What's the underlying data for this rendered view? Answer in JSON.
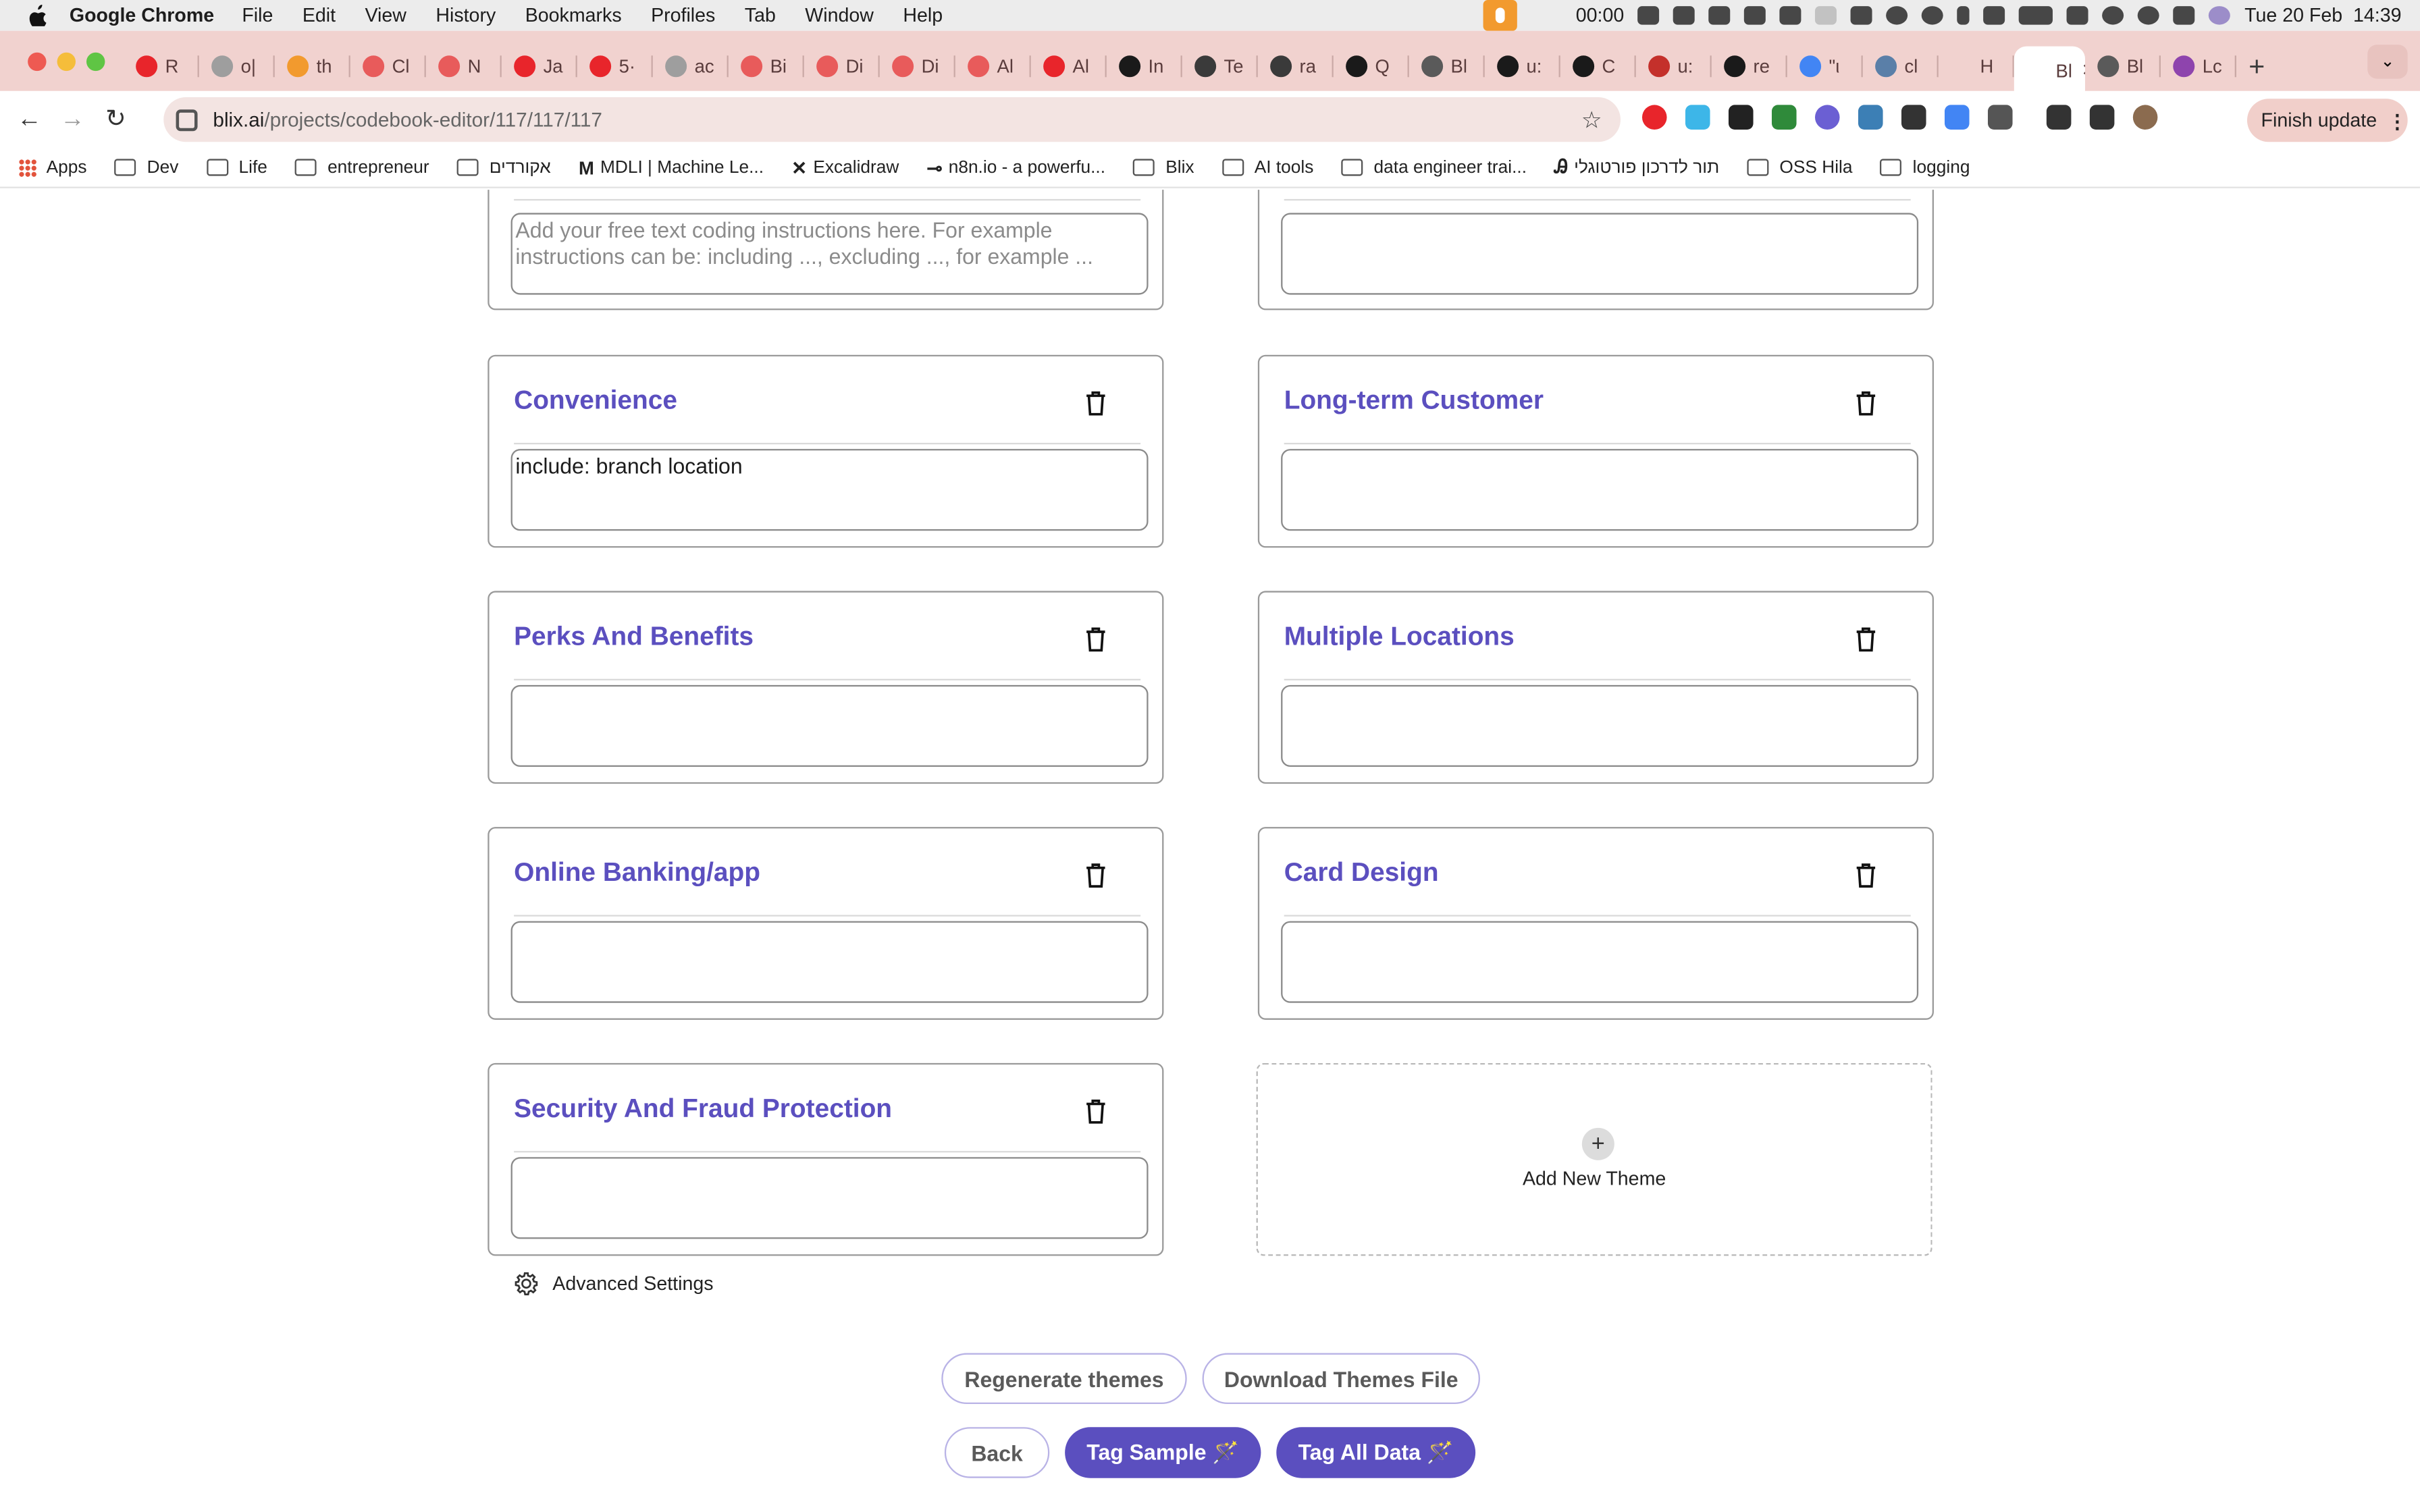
{
  "menubar": {
    "app_name": "Google Chrome",
    "items": [
      "File",
      "Edit",
      "View",
      "History",
      "Bookmarks",
      "Profiles",
      "Tab",
      "Window",
      "Help"
    ],
    "clock": "00:00",
    "datetime": "Tue 20 Feb  14:39"
  },
  "tabs": [
    {
      "label": "R",
      "color": "#e8252b"
    },
    {
      "label": "o|",
      "color": "#9e9e9e"
    },
    {
      "label": "th",
      "color": "#f29a2e"
    },
    {
      "label": "Cl",
      "color": "#e85b5b"
    },
    {
      "label": "N",
      "color": "#e85b5b"
    },
    {
      "label": "Ja",
      "color": "#e8252b"
    },
    {
      "label": "5·",
      "color": "#e8252b"
    },
    {
      "label": "ac",
      "color": "#9e9e9e"
    },
    {
      "label": "Bi",
      "color": "#e85b5b"
    },
    {
      "label": "Di",
      "color": "#e85b5b"
    },
    {
      "label": "Di",
      "color": "#e85b5b"
    },
    {
      "label": "Al",
      "color": "#e85b5b"
    },
    {
      "label": "Al",
      "color": "#e8252b"
    },
    {
      "label": "In",
      "color": "#1a1a1a"
    },
    {
      "label": "Te",
      "color": "#3a3a3a"
    },
    {
      "label": "ra",
      "color": "#3a3a3a"
    },
    {
      "label": "Q",
      "color": "#1a1a1a"
    },
    {
      "label": "Bl",
      "color": "#5a5a5a"
    },
    {
      "label": "u:",
      "color": "#1a1a1a"
    },
    {
      "label": "C",
      "color": "#1a1a1a"
    },
    {
      "label": "u:",
      "color": "#c4302b"
    },
    {
      "label": "re",
      "color": "#1a1a1a"
    },
    {
      "label": "\"ι",
      "color": "#4285f4"
    },
    {
      "label": "cl",
      "color": "#5a7fa8"
    },
    {
      "label": "H",
      "color": "#f1d2cf"
    },
    {
      "label": "Bl",
      "color": "#ffffff",
      "active": true
    },
    {
      "label": "Bl",
      "color": "#5a5a5a"
    },
    {
      "label": "Lc",
      "color": "#8e44ad"
    }
  ],
  "address_bar": {
    "domain": "blix.ai",
    "path": "/projects/codebook-editor/117/117/117"
  },
  "finish_update_label": "Finish update",
  "bookmarks": [
    {
      "label": "Apps",
      "type": "apps"
    },
    {
      "label": "Dev",
      "type": "folder"
    },
    {
      "label": "Life",
      "type": "folder"
    },
    {
      "label": "entrepreneur",
      "type": "folder"
    },
    {
      "label": "אקורדים",
      "type": "folder"
    },
    {
      "label": "MDLI | Machine Le...",
      "type": "site",
      "icon": "M"
    },
    {
      "label": "Excalidraw",
      "type": "site",
      "icon": "✕"
    },
    {
      "label": "n8n.io - a powerfu...",
      "type": "site",
      "icon": "⊸"
    },
    {
      "label": "Blix",
      "type": "folder"
    },
    {
      "label": "AI tools",
      "type": "folder"
    },
    {
      "label": "data engineer trai...",
      "type": "folder"
    },
    {
      "label": "תור לדרכון פורטוגלי",
      "type": "site",
      "icon": "Ꭿ"
    },
    {
      "label": "OSS Hila",
      "type": "folder"
    },
    {
      "label": "logging",
      "type": "folder"
    }
  ],
  "top_partial": {
    "left_placeholder": "Add your free text coding instructions here. For example instructions can be: including ..., excluding ..., for example ...",
    "right_value": ""
  },
  "themes": [
    {
      "title": "Convenience",
      "instructions": "include: branch location"
    },
    {
      "title": "Long-term Customer",
      "instructions": ""
    },
    {
      "title": "Perks And Benefits",
      "instructions": ""
    },
    {
      "title": "Multiple Locations",
      "instructions": ""
    },
    {
      "title": "Online Banking/app",
      "instructions": ""
    },
    {
      "title": "Card Design",
      "instructions": ""
    },
    {
      "title": "Security And Fraud Protection",
      "instructions": ""
    }
  ],
  "add_theme_label": "Add New Theme",
  "advanced_settings_label": "Advanced Settings",
  "buttons": {
    "regenerate": "Regenerate themes",
    "download": "Download Themes File",
    "back": "Back",
    "tag_sample": "Tag Sample 🪄",
    "tag_all": "Tag All Data 🪄"
  },
  "colors": {
    "accent": "#5b4fbf",
    "tab_strip": "#f1d2cf",
    "omnibox": "#f3e4e2"
  }
}
